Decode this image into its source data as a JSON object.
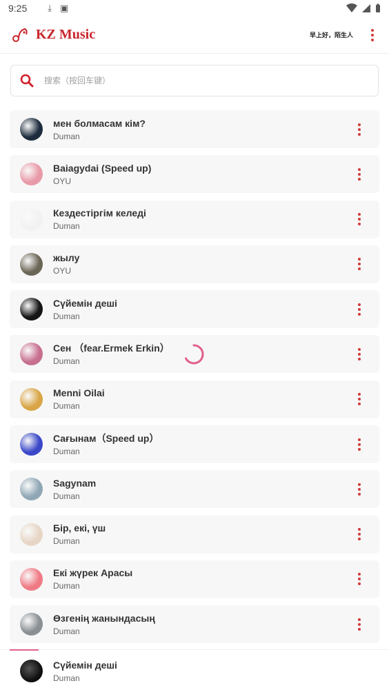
{
  "status_bar": {
    "time": "9:25",
    "icons": [
      "download-icon",
      "a-icon",
      "wifi-icon",
      "signal-icon",
      "battery-icon"
    ]
  },
  "header": {
    "title": "KZ Music",
    "greeting": "早上好，陌生人",
    "menu_icon": "more-vertical-icon",
    "accent_color": "#c8252c"
  },
  "search": {
    "placeholder": "搜索（按回车键）",
    "value": ""
  },
  "songs": [
    {
      "title": "мен болмасам кім?",
      "artist": "Duman",
      "cover_color": "#1d2c3d"
    },
    {
      "title": "Baiagydai (Speed up)",
      "artist": "OYU",
      "cover_color": "#e89aa8"
    },
    {
      "title": "Кездестіргім келеді",
      "artist": "Duman",
      "cover_color": "#f2f2f2"
    },
    {
      "title": "жылу",
      "artist": "OYU",
      "cover_color": "#6b6656"
    },
    {
      "title": "Сүйемін деші",
      "artist": "Duman",
      "cover_color": "#151515"
    },
    {
      "title": "Сен （fear.Ermek Erkin）",
      "artist": "Duman",
      "cover_color": "#c76f8f"
    },
    {
      "title": "Menni Oilai",
      "artist": "Duman",
      "cover_color": "#d9a546"
    },
    {
      "title": "Сағынам（Speed up）",
      "artist": "Duman",
      "cover_color": "#3a48c8"
    },
    {
      "title": "Sagynam",
      "artist": "Duman",
      "cover_color": "#8fa7b5"
    },
    {
      "title": "Бір, екі, үш",
      "artist": "Duman",
      "cover_color": "#e7d6c6"
    },
    {
      "title": "Екі жүрек Арасы",
      "artist": "Duman",
      "cover_color": "#f07a84"
    },
    {
      "title": "Өзгенің жанындасың",
      "artist": "Duman",
      "cover_color": "#8a8f94"
    }
  ],
  "now_playing": {
    "title": "Сүйемін деші",
    "artist": "Duman",
    "progress_color": "#e0608a"
  },
  "loading": true
}
